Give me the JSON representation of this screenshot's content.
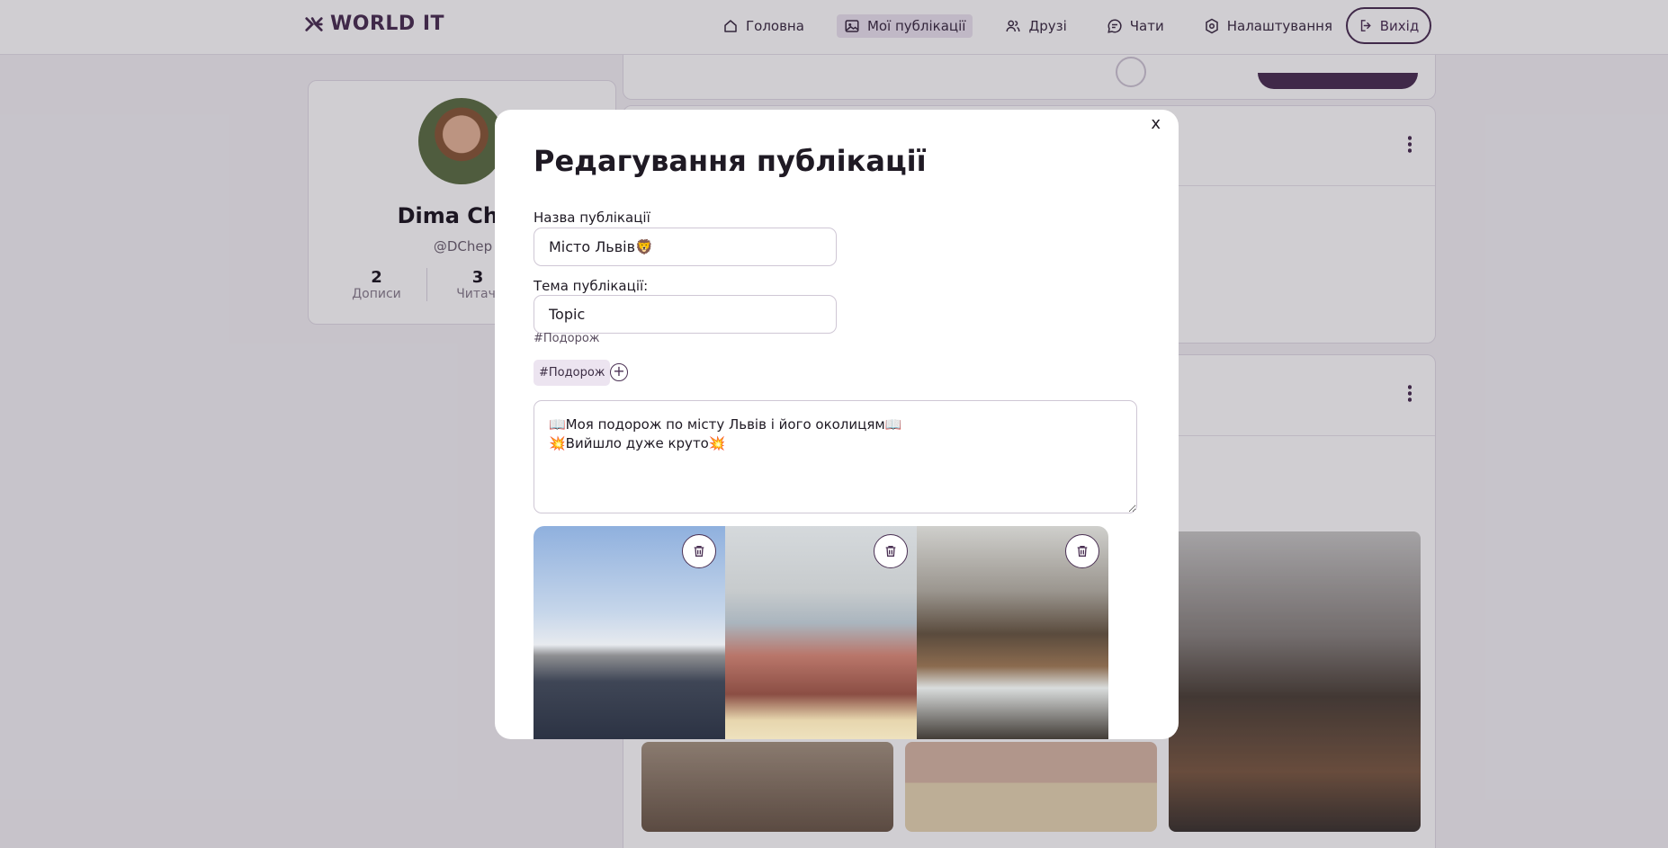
{
  "app": {
    "logo_text": "WORLD IT",
    "brand_color": "#4b3154"
  },
  "nav": {
    "items": [
      {
        "label": "Головна",
        "icon": "home-icon"
      },
      {
        "label": "Мої публікації",
        "icon": "image-icon",
        "active": true
      },
      {
        "label": "Друзі",
        "icon": "users-icon"
      },
      {
        "label": "Чати",
        "icon": "chat-icon"
      },
      {
        "label": "Налаштування",
        "icon": "gear-icon"
      }
    ],
    "logout_label": "Вихід"
  },
  "profile": {
    "name": "Dima Chep",
    "handle": "@DChep",
    "stats": [
      {
        "value": "2",
        "label": "Дописи"
      },
      {
        "value": "3",
        "label": "Читачі"
      }
    ]
  },
  "modal": {
    "close_label": "x",
    "title": "Редагування публікації",
    "name_label": "Назва публікації",
    "name_value": "Місто Львів🦁",
    "topic_label": "Тема публікації:",
    "topic_value": "Topic",
    "topic_hint": "#Подорож",
    "tags": [
      "#Подорож"
    ],
    "add_tag_symbol": "+",
    "text_value": "📖Моя подорож по місту Львів і його околицям📖\n💥Вийшло дуже круто💥",
    "images": [
      {
        "alt": "sky-road-photo"
      },
      {
        "alt": "rooftops-photo"
      },
      {
        "alt": "waterfall-photo"
      }
    ]
  }
}
